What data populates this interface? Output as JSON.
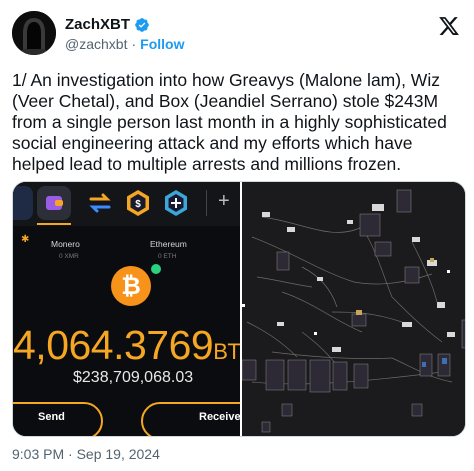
{
  "author": {
    "name": "ZachXBT",
    "handle": "@zachxbt",
    "separator": "·",
    "follow_label": "Follow"
  },
  "tweet": {
    "text": "1/ An investigation into how Greavys (Malone lam), Wiz (Veer Chetal), and Box (Jeandiel Serrano) stole $243M from a single person last month in a highly sophisticated social engineering attack and my efforts which have helped lead to multiple arrests and millions frozen.",
    "timestamp": "9:03 PM · Sep 19, 2024"
  },
  "wallet_screenshot": {
    "coins": [
      {
        "name": "Monero",
        "amount": "0 XMR"
      },
      {
        "name": "Ethereum",
        "amount": "0 ETH"
      }
    ],
    "balance": "4,064.3769",
    "balance_unit": "BT",
    "usd_value": "$238,709,068.03",
    "send_label": "Send",
    "receive_label": "Receive"
  },
  "colors": {
    "link_blue": "#1d9bf0",
    "bitcoin_orange": "#f5a623",
    "muted_text": "#536471"
  },
  "icons": [
    "verified-badge-icon",
    "x-logo-icon",
    "bitcoin-icon",
    "swap-icon",
    "hex-coin-icon",
    "plus-icon",
    "wallet-icon"
  ]
}
